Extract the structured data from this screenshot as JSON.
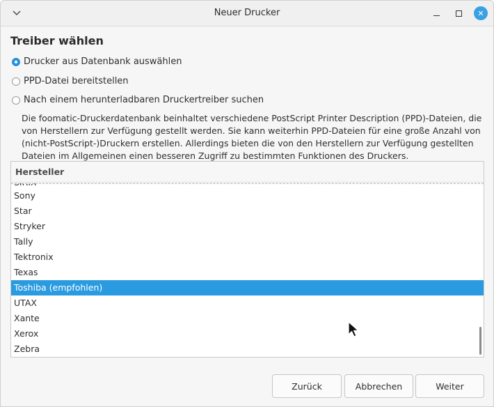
{
  "window": {
    "title": "Neuer Drucker",
    "menu_icon": "chevron-down-icon",
    "minimize_icon": "minimize-icon",
    "maximize_icon": "maximize-icon",
    "close_icon": "close-icon",
    "close_glyph": "✕",
    "accent_color": "#3aa0e4"
  },
  "section_title": "Treiber wählen",
  "options": [
    {
      "label": "Drucker aus Datenbank auswählen",
      "checked": true
    },
    {
      "label": "PPD-Datei bereitstellen",
      "checked": false
    },
    {
      "label": "Nach einem herunterladbaren Druckertreiber suchen",
      "checked": false
    }
  ],
  "description": "Die foomatic-Druckerdatenbank beinhaltet verschiedene PostScript Printer Description (PPD)-Dateien, die von Herstellern zur Verfügung gestellt werden. Sie kann weiterhin PPD-Dateien für eine große Anzahl von (nicht-PostScript-)Druckern erstellen. Allerdings bieten die von den Herstellern zur Verfügung gestellten Dateien im Allgemeinen einen besseren Zugriff zu bestimmten Funktionen des Druckers.",
  "list": {
    "header": "Hersteller",
    "cut_item": "SIRIX",
    "items": [
      {
        "label": "Sony",
        "selected": false
      },
      {
        "label": "Star",
        "selected": false
      },
      {
        "label": "Stryker",
        "selected": false
      },
      {
        "label": "Tally",
        "selected": false
      },
      {
        "label": "Tektronix",
        "selected": false
      },
      {
        "label": "Texas",
        "selected": false
      },
      {
        "label": "Toshiba (empfohlen)",
        "selected": true
      },
      {
        "label": "UTAX",
        "selected": false
      },
      {
        "label": "Xante",
        "selected": false
      },
      {
        "label": "Xerox",
        "selected": false
      },
      {
        "label": "Zebra",
        "selected": false
      }
    ],
    "selection_color": "#2a9be0"
  },
  "buttons": {
    "back": "Zurück",
    "cancel": "Abbrechen",
    "next": "Weiter"
  }
}
